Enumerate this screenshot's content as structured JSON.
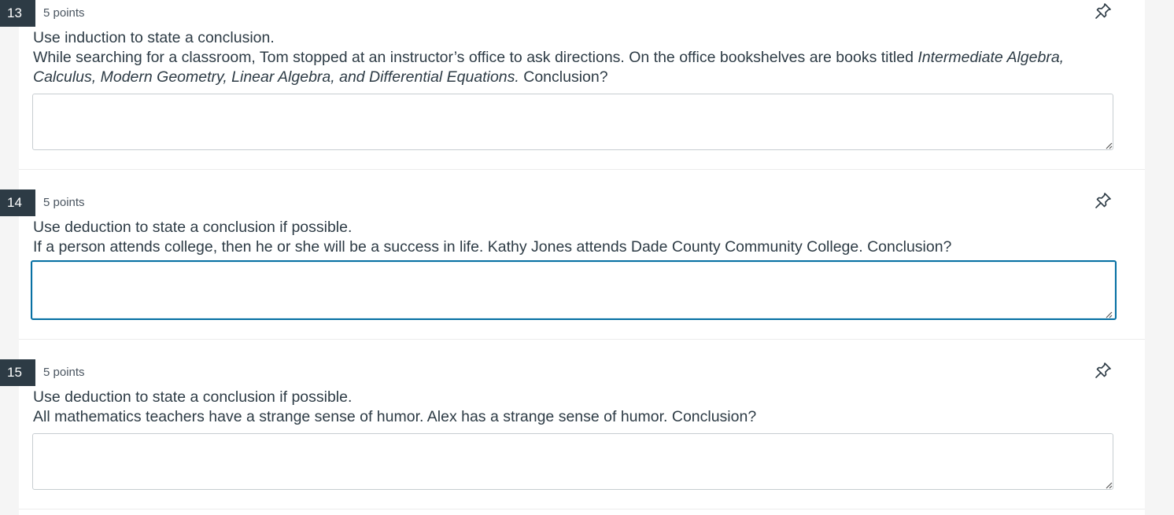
{
  "questions": [
    {
      "number": "13",
      "points": "5 points",
      "instruction": "Use induction to state a conclusion.",
      "prompt_parts": [
        {
          "text": "While searching for a classroom, Tom stopped at an instructor’s office to ask directions. On the office bookshelves are books titled ",
          "italic": false
        },
        {
          "text": "Intermediate Algebra, Calculus, Modern Geometry, Linear Algebra, and Differential Equations.",
          "italic": true
        },
        {
          "text": " Conclusion?",
          "italic": false
        }
      ],
      "answer_value": "",
      "focused": false,
      "pin_icon": "pin-icon"
    },
    {
      "number": "14",
      "points": "5 points",
      "instruction": "Use deduction to state a conclusion if possible.",
      "prompt_parts": [
        {
          "text": "If a person attends college, then he or she will be a success in life. Kathy Jones attends Dade County Community College. Conclusion?",
          "italic": false
        }
      ],
      "answer_value": "",
      "focused": true,
      "pin_icon": "pin-icon"
    },
    {
      "number": "15",
      "points": "5 points",
      "instruction": "Use deduction to state a conclusion if possible.",
      "prompt_parts": [
        {
          "text": "All mathematics teachers have a strange sense of humor. Alex has a strange sense of humor. Conclusion?",
          "italic": false
        }
      ],
      "answer_value": "",
      "focused": false,
      "pin_icon": "pin-icon"
    }
  ],
  "colors": {
    "number_badge": "#2d3b45",
    "focus_border": "#0770a3",
    "text": "#2d3b45",
    "page_background": "#f5f5f5"
  }
}
